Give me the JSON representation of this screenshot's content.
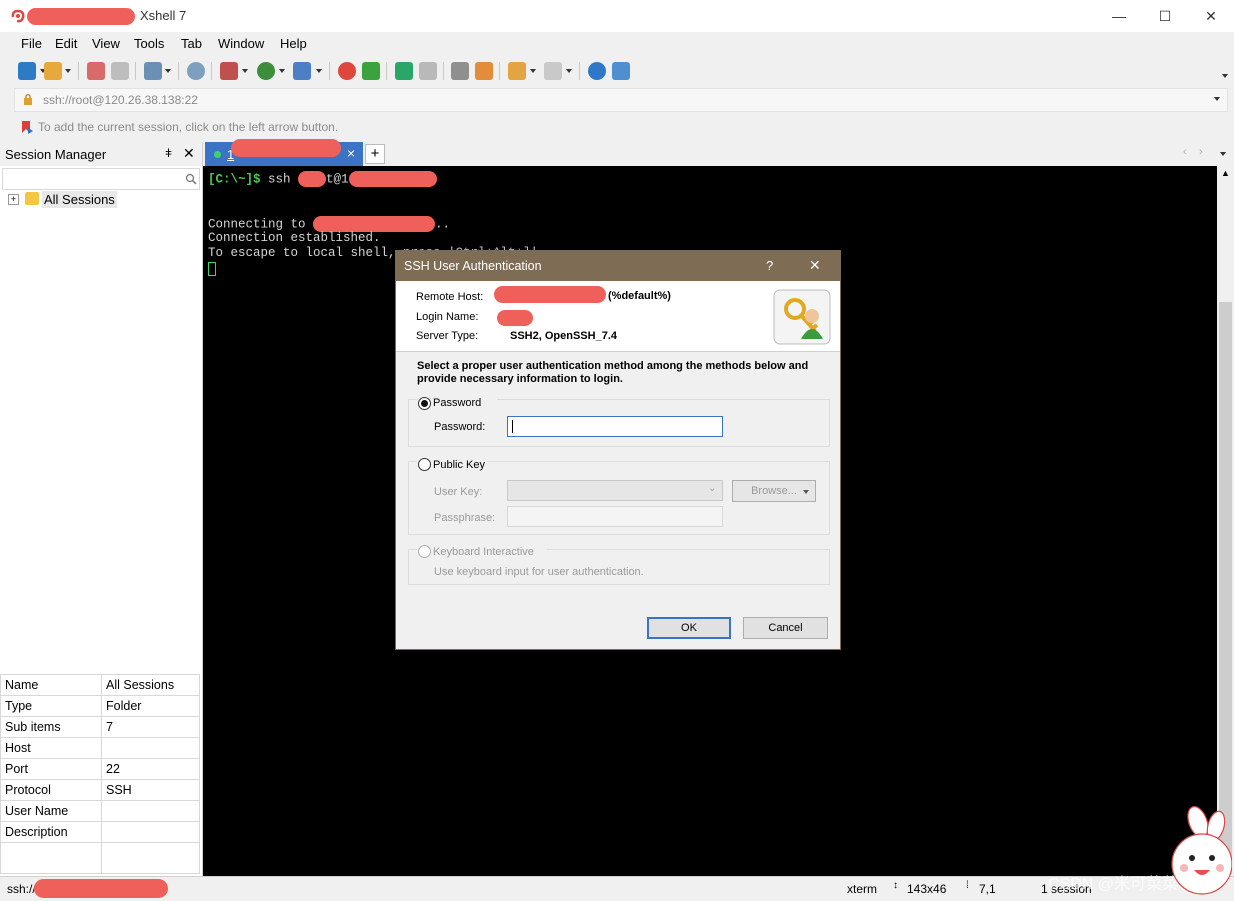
{
  "window": {
    "title": "Xshell 7",
    "controls": {
      "minimize": "—",
      "maximize": "☐",
      "close": "✕"
    }
  },
  "menu": [
    "File",
    "Edit",
    "View",
    "Tools",
    "Tab",
    "Window",
    "Help"
  ],
  "addressbar": {
    "value": "ssh://root@120.26.38.138:22"
  },
  "hint": {
    "text": "To add the current session, click on the left arrow button."
  },
  "session_manager": {
    "title": "Session Manager",
    "tree_root": "All Sessions",
    "properties": [
      {
        "key": "Name",
        "value": "All Sessions"
      },
      {
        "key": "Type",
        "value": "Folder"
      },
      {
        "key": "Sub items",
        "value": "7"
      },
      {
        "key": "Host",
        "value": ""
      },
      {
        "key": "Port",
        "value": "22"
      },
      {
        "key": "Protocol",
        "value": "SSH"
      },
      {
        "key": "User Name",
        "value": ""
      },
      {
        "key": "Description",
        "value": ""
      }
    ]
  },
  "tabs": [
    {
      "label": "1",
      "close": "×"
    }
  ],
  "terminal": {
    "prompt": "[C:\\~]$",
    "command": " ssh ",
    "at": "t@1",
    "lines": {
      "connecting": "Connecting to ",
      "connecting_suffix": "..",
      "established": "Connection established.",
      "escape": "To escape to local shell, press 'Ctrl+Alt+]'."
    }
  },
  "dialog": {
    "title": "SSH User Authentication",
    "help": "?",
    "close": "✕",
    "remote_host_label": "Remote Host:",
    "remote_host_suffix": "(%default%)",
    "login_name_label": "Login Name:",
    "server_type_label": "Server Type:",
    "server_type_value": "SSH2, OpenSSH_7.4",
    "instructions": "Select a proper user authentication method among the methods below and provide necessary information to login.",
    "password_option": "Password",
    "password_label": "Password:",
    "password_value": "",
    "publickey_option": "Public Key",
    "userkey_label": "User Key:",
    "browse_label": "Browse...",
    "passphrase_label": "Passphrase:",
    "keyboard_option": "Keyboard Interactive",
    "keyboard_desc": "Use keyboard input for user authentication.",
    "ok_label": "OK",
    "cancel_label": "Cancel"
  },
  "status": {
    "connection": "ssh://",
    "term_type": "xterm",
    "size": "143x46",
    "cursor": "7,1",
    "sessions": "1 session"
  },
  "watermark": "CSDN @米可菜菜子",
  "colors": {
    "accent": "#3b74c4",
    "dialog_title": "#7e6c55",
    "terminal_bg": "#000000",
    "prompt_green": "#4ec94e",
    "redaction": "#f0605a"
  }
}
